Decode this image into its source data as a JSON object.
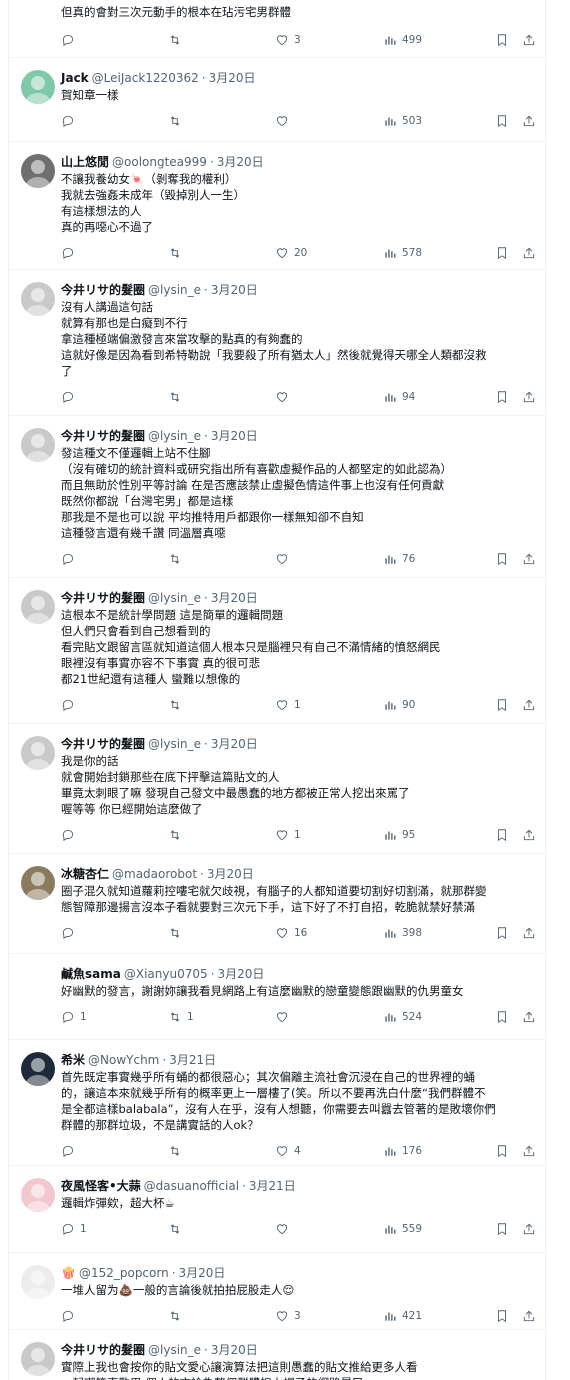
{
  "first_tweet": {
    "text": "但真的會對三次元動手的根本在玷污宅男群體",
    "likes": "3",
    "views": "499"
  },
  "tweets": [
    {
      "name": "Jack",
      "handle": "@LeiJack1220362",
      "date": "3月20日",
      "lines": [
        "賀知章一樣"
      ],
      "replies": "",
      "retweets": "",
      "likes": "",
      "views": "503",
      "avatar_color": "#7fc8a9"
    },
    {
      "name": "山上悠閒",
      "handle": "@oolongtea999",
      "date": "3月20日",
      "lines": [
        "不讓我養幼女🍬（剝奪我的權利）",
        "我就去強姦未成年（毀掉別人一生）",
        "有這樣想法的人",
        "真的再噁心不過了"
      ],
      "replies": "",
      "retweets": "",
      "likes": "20",
      "views": "578",
      "avatar_color": "#6f6f6f"
    },
    {
      "name": "今井リサ的髮圈",
      "handle": "@lysin_e",
      "date": "3月20日",
      "lines": [
        "沒有人講過這句話",
        "就算有那也是白癡到不行",
        "拿這種極端偏激發言來當攻擊的點真的有夠蠢的",
        "這就好像是因為看到希特勒說「我要殺了所有猶太人」然後就覺得天哪全人類都沒救",
        "了"
      ],
      "replies": "",
      "retweets": "",
      "likes": "",
      "views": "94",
      "avatar_color": "#c9c9c9"
    },
    {
      "name": "今井リサ的髮圈",
      "handle": "@lysin_e",
      "date": "3月20日",
      "lines": [
        "發這種文不僅邏輯上站不住腳",
        "（沒有確切的統計資料或研究指出所有喜歡虛擬作品的人都堅定的如此認為）",
        "而且無助於性別平等討論 在是否應該禁止虛擬色情這件事上也沒有任何貢獻",
        "既然你都說「台灣宅男」都是這樣",
        "那我是不是也可以說 平均推特用戶都跟你一樣無知卻不自知",
        "這種發言還有幾千讚 同溫層真噁"
      ],
      "replies": "",
      "retweets": "",
      "likes": "",
      "views": "76",
      "avatar_color": "#c9c9c9"
    },
    {
      "name": "今井リサ的髮圈",
      "handle": "@lysin_e",
      "date": "3月20日",
      "lines": [
        "這根本不是統計學問題 這是簡單的邏輯問題",
        "但人們只會看到自己想看到的",
        "看完貼文跟留言區就知道這個人根本只是腦裡只有自己不滿情緒的憤怒網民",
        "眼裡沒有事實亦容不下事實 真的很可悲",
        "都21世紀還有這種人 蠻難以想像的"
      ],
      "replies": "",
      "retweets": "",
      "likes": "1",
      "views": "90",
      "avatar_color": "#c9c9c9"
    },
    {
      "name": "今井リサ的髮圈",
      "handle": "@lysin_e",
      "date": "3月20日",
      "lines": [
        "我是你的話",
        "就會開始封鎖那些在底下抨擊這篇貼文的人",
        "畢竟太刺眼了嘛 發現自己發文中最愚蠢的地方都被正常人挖出來罵了",
        "喔等等 你已經開始這麼做了"
      ],
      "replies": "",
      "retweets": "",
      "likes": "1",
      "views": "95",
      "avatar_color": "#c9c9c9"
    },
    {
      "name": "冰糖杏仁",
      "handle": "@madaorobot",
      "date": "3月20日",
      "lines": [
        "圈子混久就知道蘿莉控嘍宅就欠歧視，有腦子的人都知道要切割好切割滿，就那群變",
        "態智障那邊揚言沒本子看就要對三次元下手，這下好了不打自招，乾脆就禁好禁滿"
      ],
      "replies": "",
      "retweets": "",
      "likes": "16",
      "views": "398",
      "avatar_color": "#8a7a5e"
    },
    {
      "name": "鹹魚sama",
      "handle": "@Xianyu0705",
      "date": "3月20日",
      "lines": [
        "好幽默的發言，謝謝妳讓我看見網路上有這麼幽默的戀童變態跟幽默的仇男童女"
      ],
      "replies": "1",
      "retweets": "1",
      "likes": "",
      "views": "524",
      "avatar_color": "#ffffff"
    },
    {
      "name": "希米",
      "handle": "@NowYchm",
      "date": "3月21日",
      "lines": [
        "首先既定事實幾乎所有蛹的都很惡心；其次偏離主流社會沉浸在自己的世界裡的蛹",
        "的，讓這本來就幾乎所有的概率更上一層樓了(笑。所以不要再洗白什麼“我們群體不",
        "是全都這樣balabala”，沒有人在乎，沒有人想聽，你需要去叫囂去管著的是敗壞你們",
        "群體的那群垃圾，不是講實話的人ok？"
      ],
      "replies": "",
      "retweets": "",
      "likes": "4",
      "views": "176",
      "avatar_color": "#1e2a3a"
    },
    {
      "name": "夜風怪客•大蒜",
      "handle": "@dasuanofficial",
      "date": "3月21日",
      "lines": [
        "邏輯炸彈欸，超大杯☕"
      ],
      "replies": "1",
      "retweets": "",
      "likes": "",
      "views": "559",
      "avatar_color": "#f2c7cf"
    },
    {
      "name": "🍿",
      "handle": "@152_popcorn",
      "date": "3月20日",
      "lines": [
        "一堆人留为💩一般的言論後就拍拍屁股走人😌"
      ],
      "replies": "",
      "retweets": "",
      "likes": "3",
      "views": "421",
      "avatar_color": "#ececec"
    },
    {
      "name": "今井リサ的髮圈",
      "handle": "@lysin_e",
      "date": "3月20日",
      "lines": [
        "實際上我也會按你的貼文愛心讓演算法把這則愚蠢的貼文推給更多人看",
        "一起嘲笑真敬甩 個人的言論為整個群體扣上帽子的網路暴民"
      ],
      "replies": "",
      "retweets": "",
      "likes": "",
      "views": "",
      "avatar_color": "#c9c9c9"
    }
  ],
  "icons": {
    "reply": "reply-icon",
    "retweet": "retweet-icon",
    "like": "heart-icon",
    "views": "views-icon",
    "bookmark": "bookmark-icon",
    "share": "share-icon"
  }
}
